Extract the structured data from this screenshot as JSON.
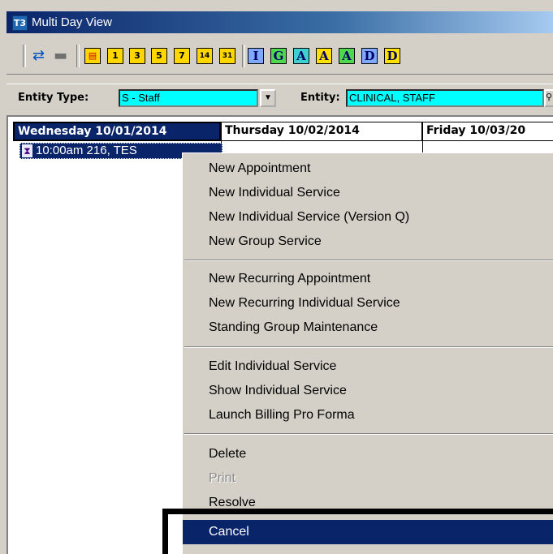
{
  "window": {
    "title": "Multi Day View",
    "icon_label": "T3"
  },
  "toolbar": {
    "refresh_icon": "refresh-icon",
    "print_icon": "printer-icon",
    "day_buttons": [
      "1",
      "3",
      "5",
      "7",
      "14",
      "31"
    ],
    "letter_buttons": [
      "I",
      "G",
      "A",
      "A",
      "A",
      "D",
      "D"
    ]
  },
  "entity": {
    "type_label": "Entity Type:",
    "type_value": "S - Staff",
    "entity_label": "Entity:",
    "entity_value": "CLINICAL, STAFF"
  },
  "calendar": {
    "days": [
      {
        "label": "Wednesday 10/01/2014",
        "selected": true
      },
      {
        "label": "Thursday 10/02/2014",
        "selected": false
      },
      {
        "label": "Friday 10/03/20",
        "selected": false
      }
    ],
    "appointment": "10:00am 216, TES"
  },
  "context_menu": {
    "groups": [
      [
        "New Appointment",
        "New Individual Service",
        "New Individual Service (Version Q)",
        "New Group Service"
      ],
      [
        "New Recurring Appointment",
        "New Recurring Individual Service",
        "Standing Group Maintenance"
      ],
      [
        "Edit Individual Service",
        "Show Individual Service",
        "Launch Billing Pro Forma"
      ],
      [
        "Delete",
        "Print",
        "Resolve",
        "Cancel"
      ]
    ],
    "disabled": [
      "Print"
    ],
    "highlighted": "Cancel"
  },
  "colors": {
    "selection": "#0a246a",
    "entity_field": "#00ffff",
    "annotation_box": "#000000"
  }
}
